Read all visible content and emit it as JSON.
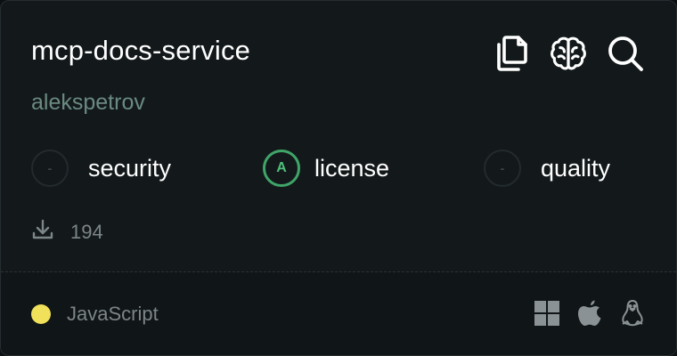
{
  "server": {
    "name": "mcp-docs-service",
    "author": "alekspetrov",
    "downloads": "194",
    "language": "JavaScript"
  },
  "actions": [
    {
      "icon": "copy-icon"
    },
    {
      "icon": "brain-icon"
    },
    {
      "icon": "search-icon"
    }
  ],
  "scores": {
    "security": {
      "grade": "-",
      "label": "security"
    },
    "license": {
      "grade": "A",
      "label": "license"
    },
    "quality": {
      "grade": "-",
      "label": "quality"
    }
  },
  "platforms": [
    "windows-icon",
    "apple-icon",
    "linux-icon"
  ],
  "colors": {
    "accent_grade": "#3fa568",
    "language_dot": "#f1e05a",
    "author": "#6a8a80",
    "background": "#13191b"
  }
}
